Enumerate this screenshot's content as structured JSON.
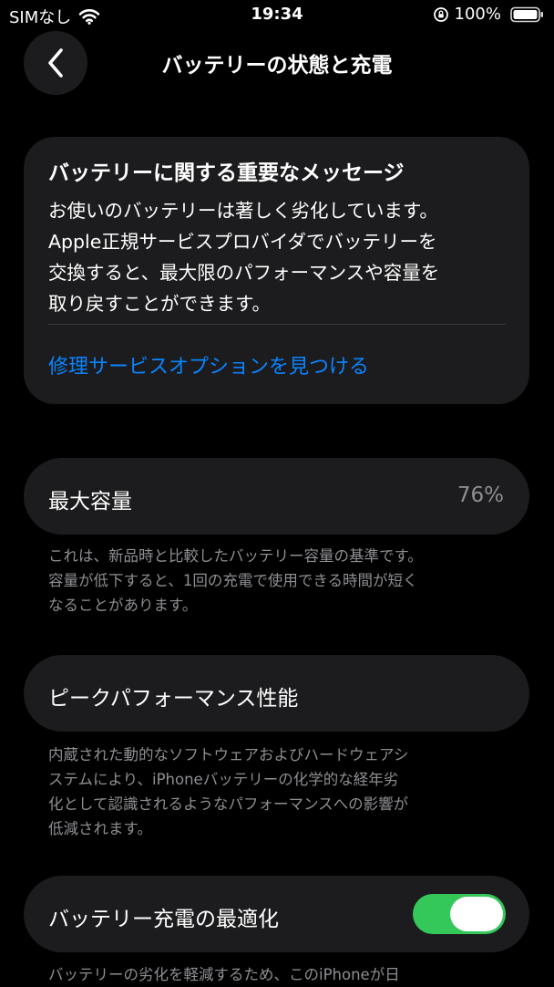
{
  "status_bar": {
    "carrier": "SIMなし",
    "time": "19:34",
    "battery_percent": "100%"
  },
  "nav": {
    "title": "バッテリーの状態と充電"
  },
  "message_card": {
    "title": "バッテリーに関する重要なメッセージ",
    "body_lines": [
      "お使いのバッテリーは著しく劣化しています。",
      "Apple正規サービスプロバイダでバッテリーを",
      "交換すると、最大限のパフォーマンスや容量を",
      "取り戻すことができます。"
    ],
    "link": "修理サービスオプションを見つける"
  },
  "max_capacity": {
    "label": "最大容量",
    "value": "76%",
    "note_lines": [
      "これは、新品時と比較したバッテリー容量の基準です。",
      "容量が低下すると、1回の充電で使用できる時間が短く",
      "なることがあります。"
    ]
  },
  "peak_performance": {
    "label": "ピークパフォーマンス性能",
    "note_lines": [
      "内蔵された動的なソフトウェアおよびハードウェアシ",
      "ステムにより、iPhoneバッテリーの化学的な経年劣",
      "化として認識されるようなパフォーマンスへの影響が",
      "低減されます。"
    ]
  },
  "charging_optimization": {
    "label": "バッテリー充電の最適化",
    "enabled": true,
    "note_lines": [
      "バッテリーの劣化を軽減するため、このiPhoneが日"
    ]
  },
  "colors": {
    "background": "#000000",
    "card": "#1c1c1e",
    "link": "#0a84ff",
    "secondary_text": "#8e8e93",
    "toggle_on": "#34c759"
  },
  "icons": {
    "wifi": "wifi-icon",
    "rotation_lock": "rotation-lock-icon",
    "battery": "battery-icon",
    "back": "chevron-left-icon"
  }
}
